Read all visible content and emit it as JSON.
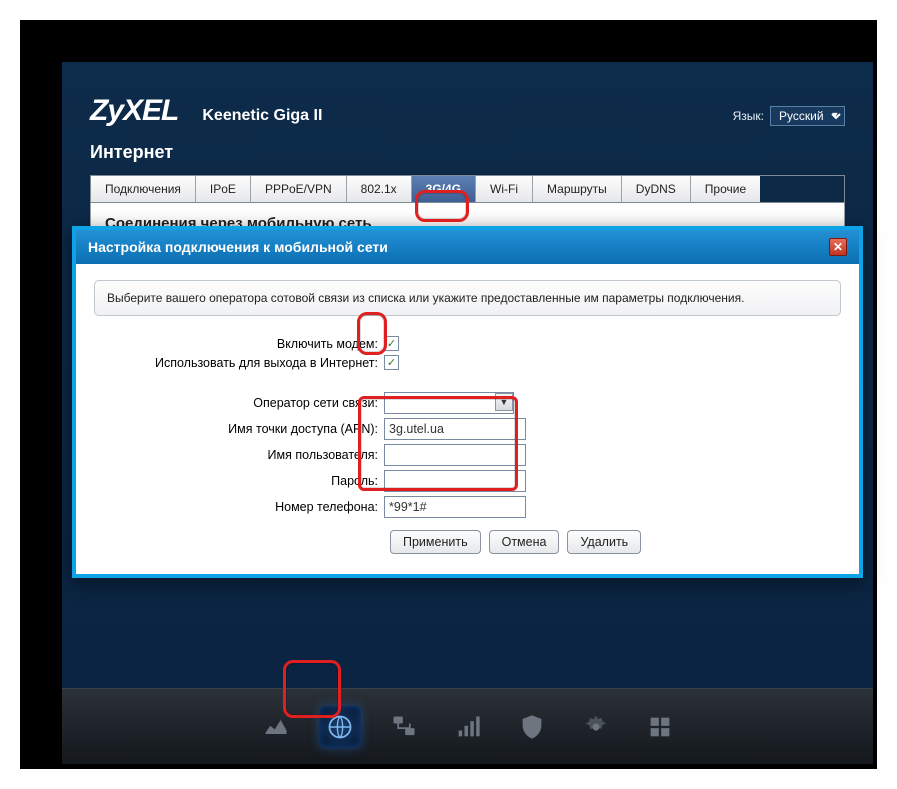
{
  "header": {
    "logo": "ZyXEL",
    "model": "Keenetic Giga II",
    "lang_label": "Язык:",
    "lang_value": "Русский"
  },
  "section_title": "Интернет",
  "tabs": [
    {
      "label": "Подключения"
    },
    {
      "label": "IPoE"
    },
    {
      "label": "PPPoE/VPN"
    },
    {
      "label": "802.1x"
    },
    {
      "label": "3G/4G",
      "active": true
    },
    {
      "label": "Wi-Fi"
    },
    {
      "label": "Маршруты"
    },
    {
      "label": "DyDNS"
    },
    {
      "label": "Прочие"
    }
  ],
  "panel_title": "Соединения через мобильную сеть",
  "modal": {
    "title": "Настройка подключения к мобильной сети",
    "hint": "Выберите вашего оператора сотовой связи из списка или укажите предоставленные им параметры подключения.",
    "labels": {
      "enable_modem": "Включить модем:",
      "use_internet": "Использовать для выхода в Интернет:",
      "operator": "Оператор сети связи:",
      "apn": "Имя точки доступа (APN):",
      "username": "Имя пользователя:",
      "password": "Пароль:",
      "phone": "Номер телефона:"
    },
    "values": {
      "enable_modem": true,
      "use_internet": true,
      "operator": "",
      "apn": "3g.utel.ua",
      "username": "",
      "password": "",
      "phone": "*99*1#"
    },
    "buttons": {
      "apply": "Применить",
      "cancel": "Отмена",
      "delete": "Удалить"
    }
  },
  "nav_icons": [
    "chart-icon",
    "globe-icon",
    "network-icon",
    "signal-icon",
    "shield-icon",
    "gear-icon",
    "grid-icon"
  ]
}
